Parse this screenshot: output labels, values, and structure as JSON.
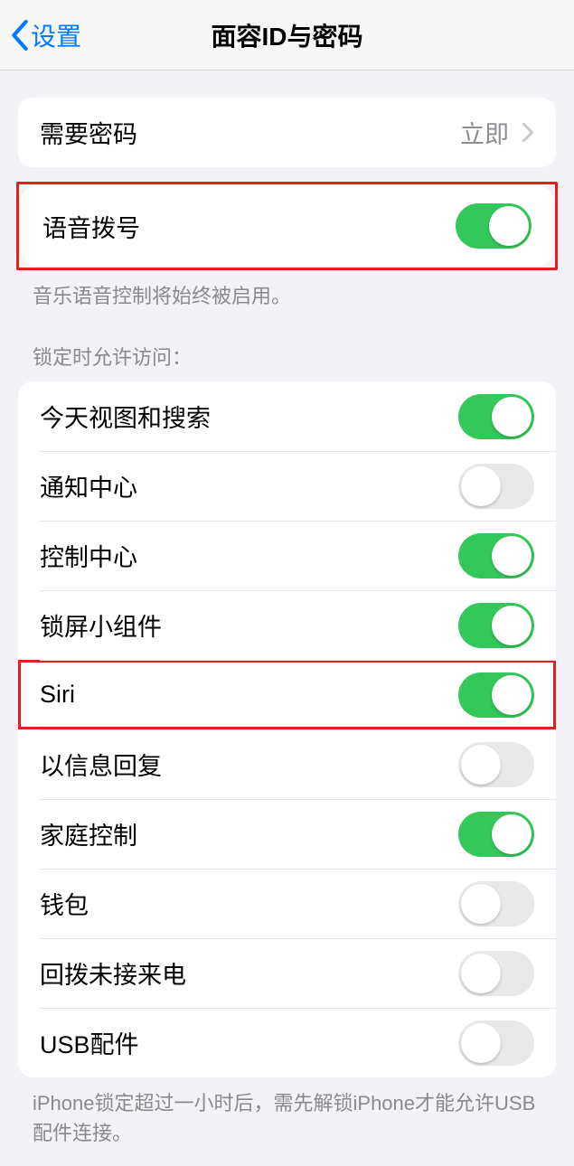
{
  "nav": {
    "back_label": "设置",
    "title": "面容ID与密码"
  },
  "require_passcode": {
    "label": "需要密码",
    "value": "立即"
  },
  "voice_dial": {
    "label": "语音拨号",
    "footer": "音乐语音控制将始终被启用。"
  },
  "lock_header": "锁定时允许访问：",
  "lock_items": {
    "today": "今天视图和搜索",
    "notification": "通知中心",
    "control": "控制中心",
    "widgets": "锁屏小组件",
    "siri": "Siri",
    "reply": "以信息回复",
    "home": "家庭控制",
    "wallet": "钱包",
    "callback": "回拨未接来电",
    "usb": "USB配件"
  },
  "bottom_footer": "iPhone锁定超过一小时后，需先解锁iPhone才能允许USB配件连接。"
}
